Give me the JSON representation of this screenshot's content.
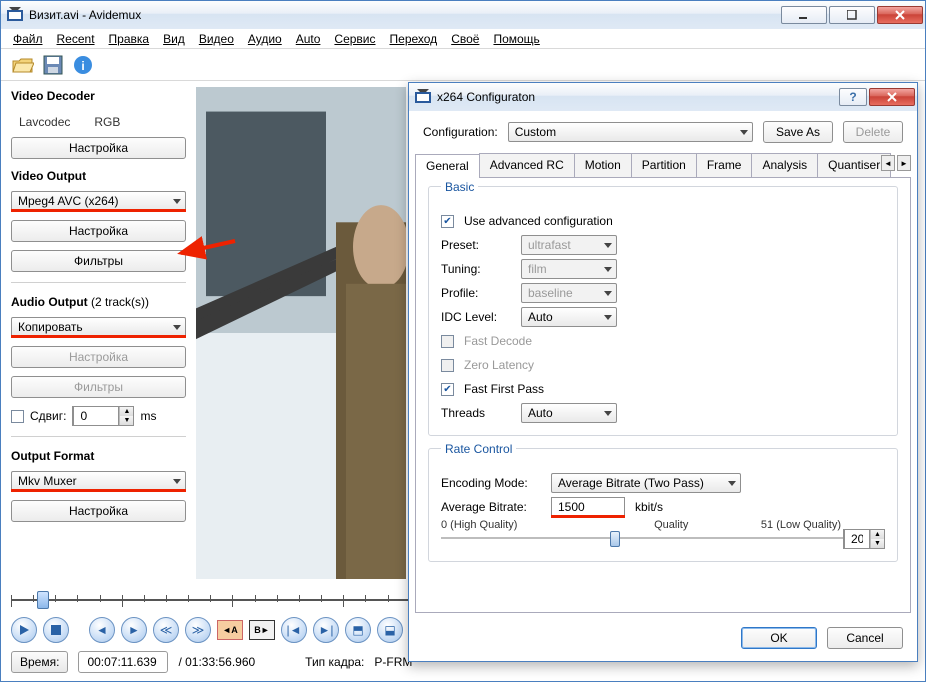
{
  "main_window": {
    "title": "Визит.avi - Avidemux",
    "menu": [
      "Файл",
      "Recent",
      "Правка",
      "Вид",
      "Видео",
      "Аудио",
      "Auto",
      "Сервис",
      "Переход",
      "Своё",
      "Помощь"
    ],
    "sections": {
      "video_decoder": "Video Decoder",
      "lavcodec": "Lavcodec",
      "rgb": "RGB",
      "video_output": "Video Output",
      "audio_output": "Audio Output",
      "audio_output_paren": "(2 track(s))",
      "output_format": "Output Format"
    },
    "buttons": {
      "configure": "Настройка",
      "filters": "Фильтры"
    },
    "combos": {
      "video_codec": "Mpeg4 AVC (x264)",
      "audio_codec": "Копировать",
      "muxer": "Mkv Muxer"
    },
    "shift_label": "Сдвиг:",
    "shift_value": "0",
    "shift_unit": "ms",
    "status": {
      "time_label": "Время:",
      "time_value": "00:07:11.639",
      "duration": "/ 01:33:56.960",
      "frame_type_label": "Тип кадра:",
      "frame_type_value": "P-FRM"
    }
  },
  "dialog": {
    "title": "x264 Configuraton",
    "config_label": "Configuration:",
    "config_value": "Custom",
    "save_as": "Save As",
    "delete": "Delete",
    "tabs": [
      "General",
      "Advanced RC",
      "Motion",
      "Partition",
      "Frame",
      "Analysis",
      "Quantiser"
    ],
    "basic": {
      "group": "Basic",
      "use_adv": "Use advanced configuration",
      "preset": "Preset:",
      "preset_value": "ultrafast",
      "tuning": "Tuning:",
      "tuning_value": "film",
      "profile": "Profile:",
      "profile_value": "baseline",
      "idc": "IDC Level:",
      "idc_value": "Auto",
      "fast_decode": "Fast Decode",
      "zero_latency": "Zero Latency",
      "fast_first_pass": "Fast First Pass",
      "threads": "Threads",
      "threads_value": "Auto"
    },
    "rate": {
      "group": "Rate Control",
      "mode_label": "Encoding Mode:",
      "mode_value": "Average Bitrate (Two Pass)",
      "bitrate_label": "Average Bitrate:",
      "bitrate_value": "1500",
      "bitrate_unit": "kbit/s",
      "q_lo": "0 (High Quality)",
      "q_label": "Quality",
      "q_hi": "51 (Low Quality)",
      "q_side": "20"
    },
    "ok": "OK",
    "cancel": "Cancel"
  }
}
